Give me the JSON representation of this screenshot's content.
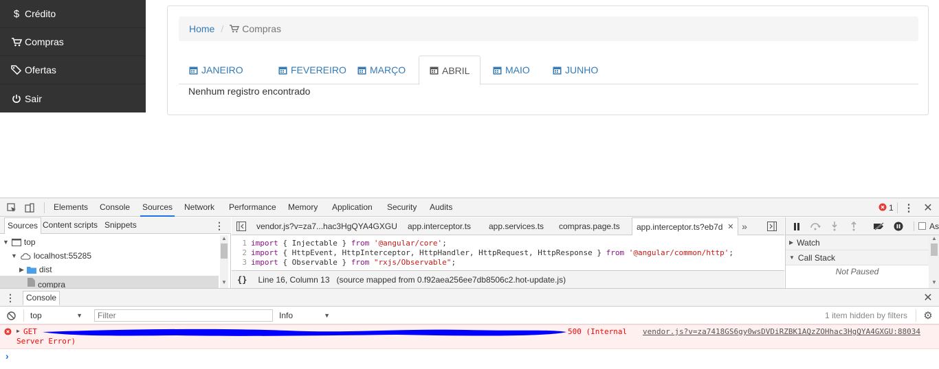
{
  "sidebar": {
    "items": [
      {
        "icon": "dollar-icon",
        "label": "Crédito"
      },
      {
        "icon": "cart-icon",
        "label": "Compras"
      },
      {
        "icon": "tags-icon",
        "label": "Ofertas"
      },
      {
        "icon": "power-icon",
        "label": "Sair"
      }
    ]
  },
  "breadcrumb": {
    "home": "Home",
    "separator": "/",
    "current": "Compras"
  },
  "tabs": [
    {
      "label": "JANEIRO",
      "active": false
    },
    {
      "label": "FEVEREIRO",
      "active": false
    },
    {
      "label": "MARÇO",
      "active": false
    },
    {
      "label": "ABRIL",
      "active": true
    },
    {
      "label": "MAIO",
      "active": false
    },
    {
      "label": "JUNHO",
      "active": false
    }
  ],
  "main": {
    "empty_message": "Nenhum registro encontrado"
  },
  "devtools": {
    "tabs": [
      "Elements",
      "Console",
      "Sources",
      "Network",
      "Performance",
      "Memory",
      "Application",
      "Security",
      "Audits"
    ],
    "active_tab": "Sources",
    "error_count": "1",
    "sources_nav": {
      "tabs": [
        "Sources",
        "Content scripts",
        "Snippets"
      ],
      "tree": {
        "top": "top",
        "host": "localhost:55285",
        "folder": "dist",
        "file": "compra"
      }
    },
    "editor": {
      "tabs": [
        "vendor.js?v=za7...hac3HgQYA4GXGU",
        "app.interceptor.ts",
        "app.services.ts",
        "compras.page.ts",
        "app.interceptor.ts?eb7d"
      ],
      "code": [
        {
          "n": "1",
          "kw1": "import",
          "mid": " { Injectable } ",
          "kw2": "from",
          "str": " '@angular/core'",
          "end": ";"
        },
        {
          "n": "2",
          "kw1": "import",
          "mid": " { HttpEvent, HttpInterceptor, HttpHandler, HttpRequest, HttpResponse } ",
          "kw2": "from",
          "str": " '@angular/common/http'",
          "end": ";"
        },
        {
          "n": "3",
          "kw1": "import",
          "mid": " { Observable } ",
          "kw2": "from",
          "str": " \"rxjs/Observable\"",
          "end": ";"
        }
      ],
      "status_braces": "{}",
      "status": "Line 16, Column 13",
      "source_mapped": "(source mapped from 0.f92aea256ee7db8506c2.hot-update.js)"
    },
    "debugger": {
      "watch": "Watch",
      "call_stack": "Call Stack",
      "not_paused": "Not Paused",
      "async_label": "As"
    },
    "drawer": {
      "tab": "Console"
    },
    "console": {
      "context": "top",
      "filter_placeholder": "Filter",
      "level": "Info",
      "hidden_info": "1 item hidden by filters"
    },
    "error": {
      "method": "GET",
      "status": "500 (Internal",
      "status_cont": "Server Error)",
      "source": "vendor.js?v=za7418GS6gy0wsDVDiRZBK1AQzZOHhac3HgQYA4GXGU:88034"
    },
    "prompt": "›"
  },
  "colors": {
    "link": "#337ab7",
    "sidebar_bg": "#333333",
    "error_red": "#ff0000",
    "redaction": "#0000ff"
  }
}
